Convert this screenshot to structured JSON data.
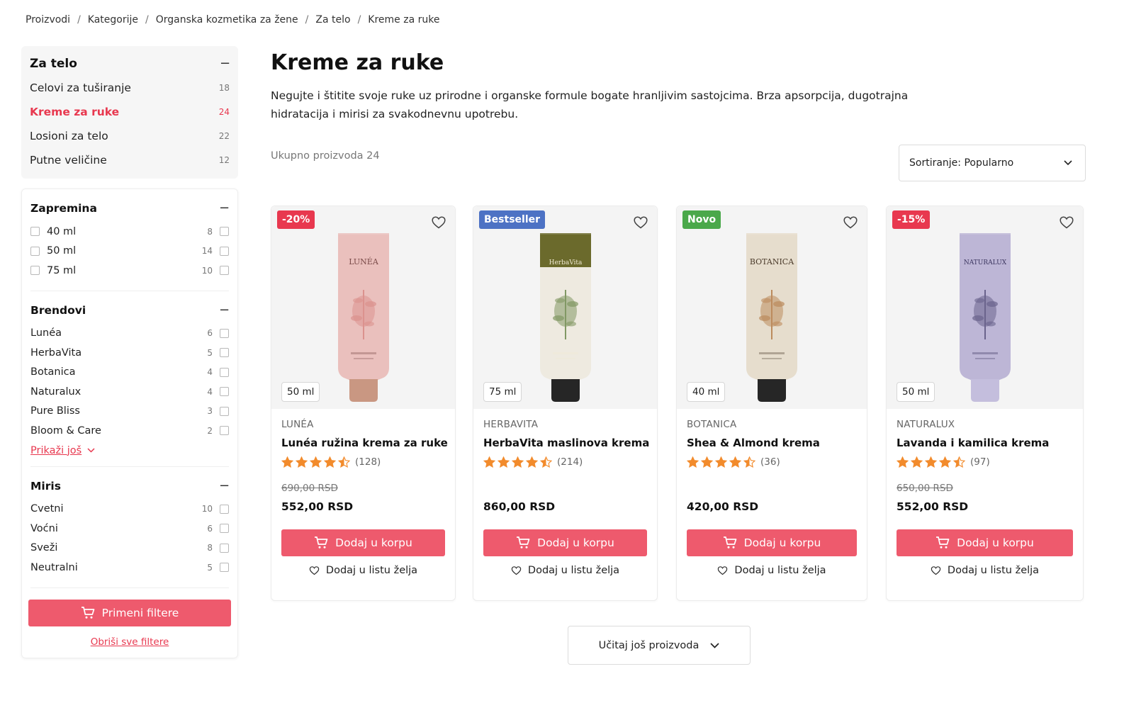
{
  "breadcrumb": [
    "Proizvodi",
    "Kategorije",
    "Organska kozmetika za žene",
    "Za telo",
    "Kreme za ruke"
  ],
  "breadcrumb_sep": "/",
  "sidebar": {
    "category_title": "Za telo",
    "categories": [
      {
        "label": "Celovi za tuširanje",
        "count": "18"
      },
      {
        "label": "Kreme za ruke",
        "count": "24",
        "active": true
      },
      {
        "label": "Losioni za telo",
        "count": "22"
      },
      {
        "label": "Putne veličine",
        "count": "12"
      }
    ],
    "volume": {
      "title": "Zapremina",
      "items": [
        {
          "label": "40 ml",
          "count": "8"
        },
        {
          "label": "50 ml",
          "count": "14"
        },
        {
          "label": "75 ml",
          "count": "10"
        }
      ]
    },
    "brands": {
      "title": "Brendovi",
      "items": [
        {
          "label": "Lunéa",
          "count": "6"
        },
        {
          "label": "HerbaVita",
          "count": "5"
        },
        {
          "label": "Botanica",
          "count": "4"
        },
        {
          "label": "Naturalux",
          "count": "4"
        },
        {
          "label": "Pure Bliss",
          "count": "3"
        },
        {
          "label": "Bloom & Care",
          "count": "2"
        }
      ],
      "show_more": "Prikaži još"
    },
    "scent": {
      "title": "Miris",
      "items": [
        {
          "label": "Cvetni",
          "count": "10"
        },
        {
          "label": "Voćni",
          "count": "6"
        },
        {
          "label": "Sveži",
          "count": "8"
        },
        {
          "label": "Neutralni",
          "count": "5"
        }
      ]
    },
    "apply_label": "Primeni filtere",
    "clear_label": "Obriši sve filtere"
  },
  "main": {
    "title": "Kreme za ruke",
    "description": "Negujte i štitite svoje ruke uz prirodne i organske formule bogate hranljivim sastojcima. Brza apsorpcija, dugotrajna hidratacija i mirisi za svakodnevnu upotrebu.",
    "total": "Ukupno proizvoda 24",
    "sort": "Sortiranje: Popularno",
    "load_more": "Učitaj još proizvoda"
  },
  "products": [
    {
      "badge": "-20%",
      "badge_color": "#e8384f",
      "volume": "50 ml",
      "brand": "LUNÉA",
      "name": "Lunéa ružina krema za ruke",
      "rating": 4.5,
      "reviews": "(128)",
      "old_price": "690,00 RSD",
      "price": "552,00 RSD",
      "tube": {
        "body": "#eac0bd",
        "cap": "#c99782",
        "label_text": "LUNÉA",
        "accent": "#d98a86",
        "text_color": "#7a4a48"
      }
    },
    {
      "badge": "Bestseller",
      "badge_color": "#4d72c4",
      "volume": "75 ml",
      "brand": "HERBAVITA",
      "name": "HerbaVita maslinova krema",
      "rating": 4.5,
      "reviews": "(214)",
      "old_price": "",
      "price": "860,00 RSD",
      "tube": {
        "body": "#eeeae0",
        "cap": "#262626",
        "top": "#6b6a2c",
        "label_text": "HerbaVita",
        "accent": "#6f8a4f",
        "text_color": "#f0ead2"
      }
    },
    {
      "badge": "Novo",
      "badge_color": "#4aa84a",
      "volume": "40 ml",
      "brand": "BOTANICA",
      "name": "Shea & Almond krema",
      "rating": 4.5,
      "reviews": "(36)",
      "old_price": "",
      "price": "420,00 RSD",
      "tube": {
        "body": "#e6ddcd",
        "cap": "#262626",
        "label_text": "BOTANICA",
        "accent": "#b57d4a",
        "text_color": "#4a3a2a"
      }
    },
    {
      "badge": "-15%",
      "badge_color": "#e8384f",
      "volume": "50 ml",
      "brand": "NATURALUX",
      "name": "Lavanda i kamilica krema",
      "rating": 4.5,
      "reviews": "(97)",
      "old_price": "650,00 RSD",
      "price": "552,00 RSD",
      "tube": {
        "body": "#bdb6d6",
        "cap": "#c4bedd",
        "label_text": "NATURALUX",
        "accent": "#5c5580",
        "text_color": "#3c3660"
      }
    }
  ],
  "card_actions": {
    "add_to_cart": "Dodaj u korpu",
    "wishlist": "Dodaj u listu želja"
  },
  "colors": {
    "accent": "#e8384f",
    "button": "#ee5a6d",
    "star": "#f28b2c"
  },
  "icons": [
    "minus-icon",
    "chevron-down-icon",
    "cart-icon",
    "heart-icon",
    "star-icon"
  ]
}
